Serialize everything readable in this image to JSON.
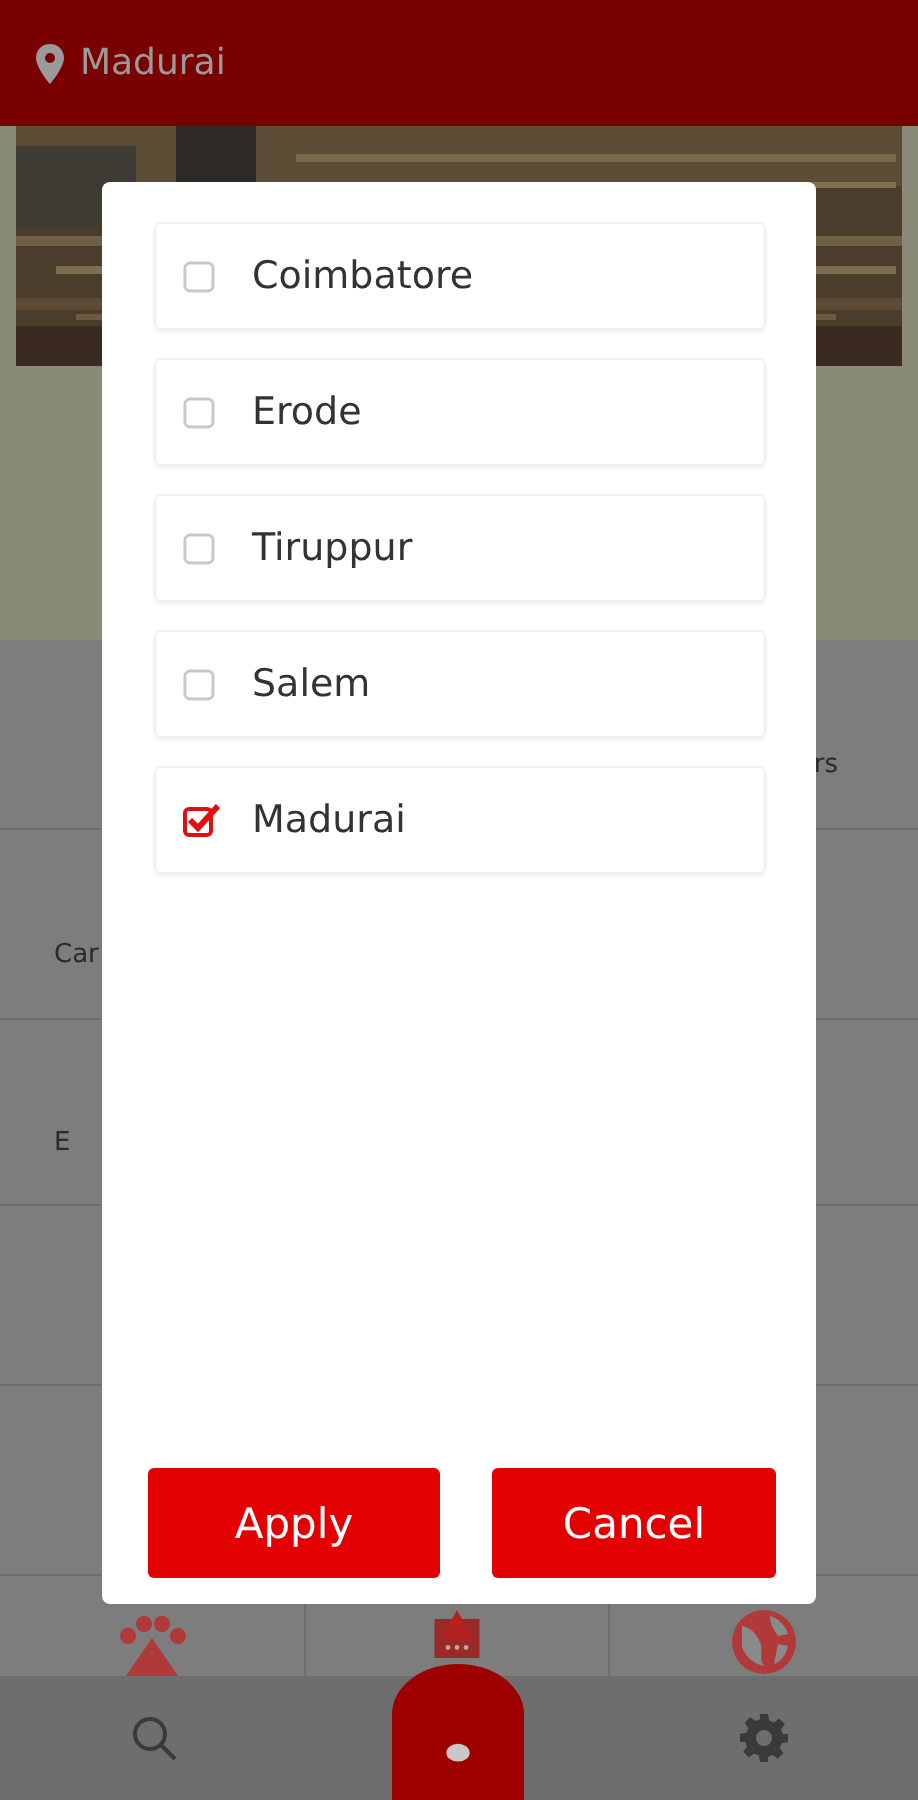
{
  "header": {
    "location": "Madurai"
  },
  "grid": {
    "rows": [
      {
        "right": "rs"
      },
      {
        "left": "Car"
      },
      {
        "left": "E"
      },
      {},
      {}
    ]
  },
  "dialog": {
    "options": [
      {
        "label": "Coimbatore",
        "checked": false
      },
      {
        "label": "Erode",
        "checked": false
      },
      {
        "label": "Tiruppur",
        "checked": false
      },
      {
        "label": "Salem",
        "checked": false
      },
      {
        "label": "Madurai",
        "checked": true
      }
    ],
    "buttons": [
      "Apply",
      "Cancel"
    ]
  }
}
